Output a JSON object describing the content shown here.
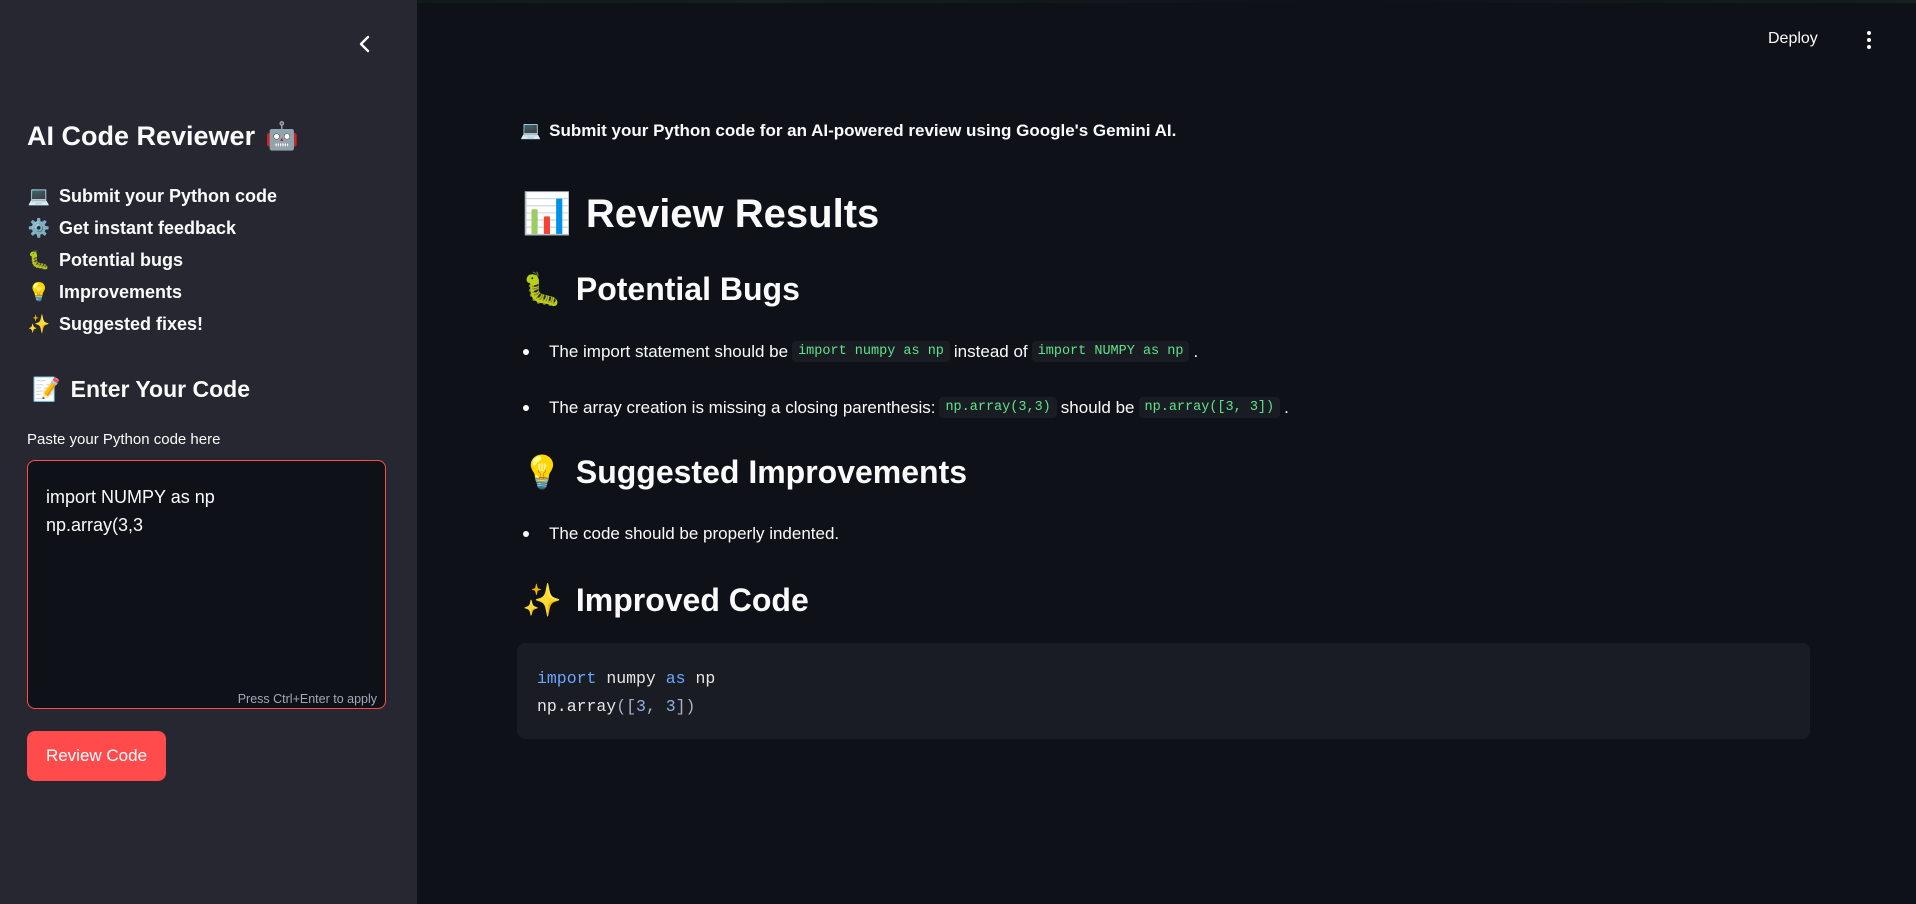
{
  "colors": {
    "primary": "#ff4b4b",
    "background": "#0e1117",
    "sidebar": "#262730",
    "inline_code": "#5ce488"
  },
  "header": {
    "deploy_label": "Deploy",
    "menu_icon": "kebab-menu-icon"
  },
  "sidebar": {
    "collapse_icon": "chevron-left-icon",
    "title": "AI Code Reviewer",
    "title_icon": "🤖",
    "features": [
      {
        "icon": "💻",
        "label": "Submit your Python code"
      },
      {
        "icon": "⚙️",
        "label": "Get instant feedback"
      },
      {
        "icon": "🐛",
        "label": "Potential bugs"
      },
      {
        "icon": "💡",
        "label": "Improvements"
      },
      {
        "icon": "✨",
        "label": "Suggested fixes!"
      }
    ],
    "enter_code": {
      "icon": "📝",
      "title": "Enter Your Code"
    },
    "code_input": {
      "label": "Paste your Python code here",
      "value": "import NUMPY as np\nnp.array(3,3",
      "hint": "Press Ctrl+Enter to apply"
    },
    "review_button": "Review Code"
  },
  "main": {
    "intro": {
      "icon": "💻",
      "text": "Submit your Python code for an AI-powered review using Google's Gemini AI."
    },
    "results_title": {
      "icon": "📊",
      "text": "Review Results"
    },
    "bugs": {
      "icon": "🐛",
      "title": "Potential Bugs",
      "items": [
        {
          "t1": "The import statement should be",
          "c1": "import numpy as np",
          "t2": "instead of",
          "c2": "import NUMPY as np",
          "t3": "."
        },
        {
          "t1": "The array creation is missing a closing parenthesis:",
          "c1": "np.array(3,3)",
          "t2": "should be",
          "c2": "np.array([3, 3])",
          "t3": "."
        }
      ]
    },
    "improvements": {
      "icon": "💡",
      "title": "Suggested Improvements",
      "items": [
        "The code should be properly indented."
      ]
    },
    "improved_code": {
      "icon": "✨",
      "title": "Improved Code",
      "line1": {
        "kw1": "import",
        "mod": "numpy",
        "kw2": "as",
        "alias": "np"
      },
      "line2": {
        "fn": "np.array",
        "open": "([",
        "n1": "3",
        "sep": ", ",
        "n2": "3",
        "close": "])"
      }
    }
  }
}
